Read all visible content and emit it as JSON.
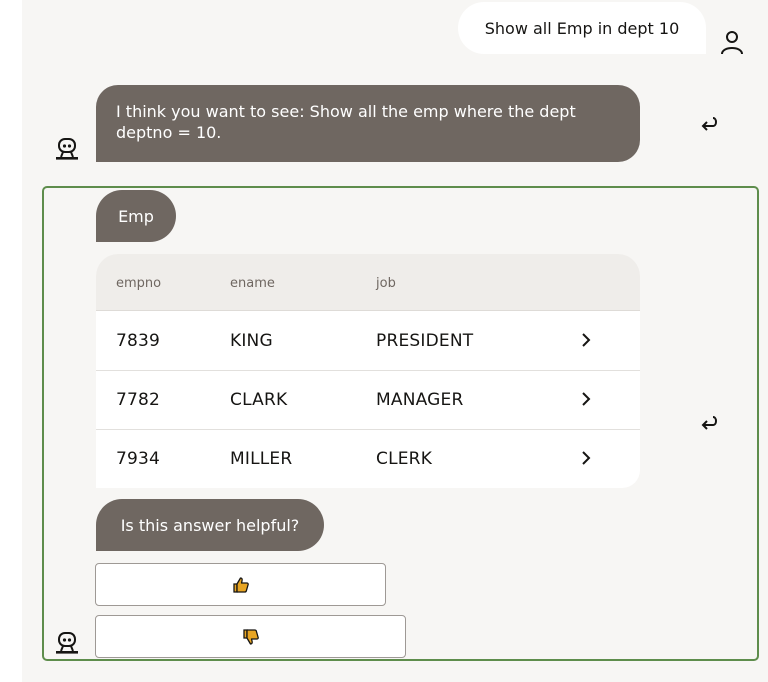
{
  "user_message": {
    "text": "Show all Emp in dept 10",
    "avatar_icon": "person-icon"
  },
  "bot_interpretation": {
    "text": "I think you want to see: Show all the emp where the dept deptno = 10.",
    "avatar_icon": "bot-icon",
    "reply_icon": "return-arrow-icon"
  },
  "result": {
    "title": "Emp",
    "columns": [
      "empno",
      "ename",
      "job"
    ],
    "rows": [
      {
        "empno": "7839",
        "ename": "KING",
        "job": "PRESIDENT"
      },
      {
        "empno": "7782",
        "ename": "CLARK",
        "job": "MANAGER"
      },
      {
        "empno": "7934",
        "ename": "MILLER",
        "job": "CLERK"
      }
    ],
    "row_action_icon": "chevron-right-icon",
    "reply_icon": "return-arrow-icon"
  },
  "feedback": {
    "question": "Is this answer helpful?",
    "thumbs_up_icon": "thumbs-up-icon",
    "thumbs_down_icon": "thumbs-down-icon",
    "icon_color": "#e8a523"
  },
  "colors": {
    "bot_bubble": "#6f6761",
    "user_bubble": "#ffffff",
    "chat_background": "#f7f6f4",
    "group_border": "#5e8d4c"
  }
}
